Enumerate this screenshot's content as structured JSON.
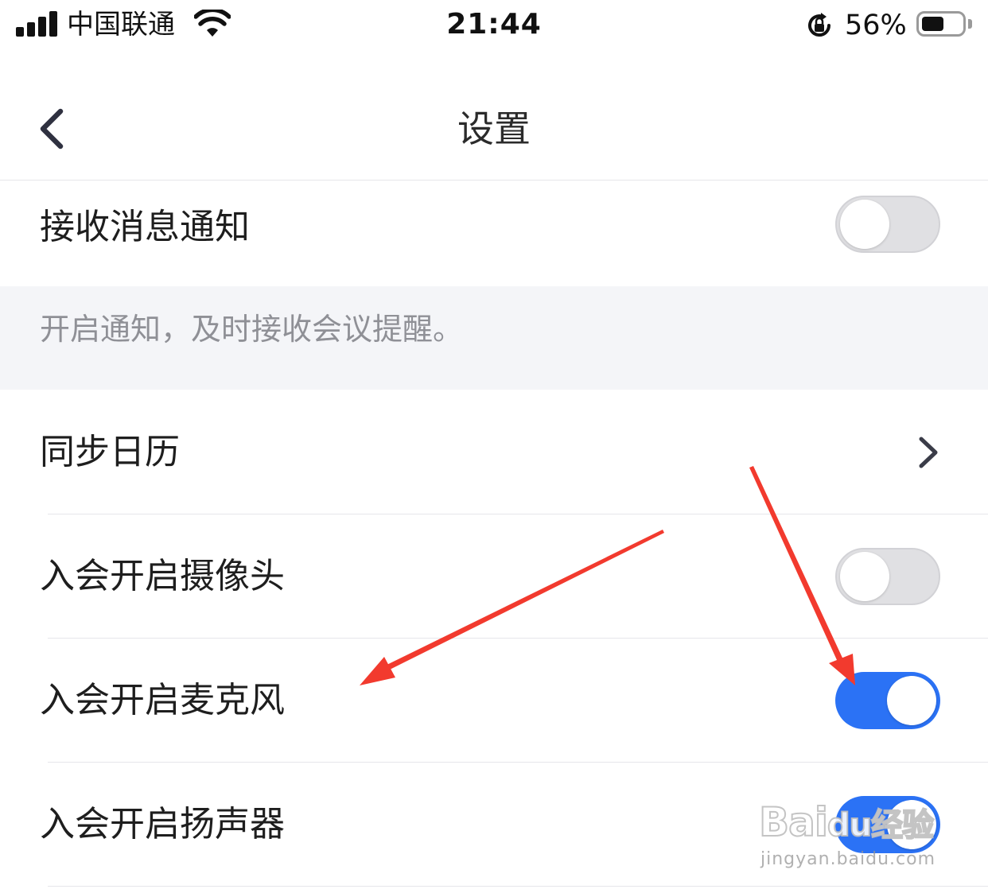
{
  "status_bar": {
    "carrier": "中国联通",
    "time": "21:44",
    "battery_percent": "56%",
    "battery_level": 0.56
  },
  "nav": {
    "title": "设置",
    "back_icon": "chevron-left-icon"
  },
  "settings": {
    "receive_notifications": {
      "label": "接收消息通知",
      "enabled": false
    },
    "notification_hint": "开启通知，及时接收会议提醒。",
    "sync_calendar": {
      "label": "同步日历",
      "icon": "chevron-right-icon"
    },
    "camera_on_join": {
      "label": "入会开启摄像头",
      "enabled": false
    },
    "mic_on_join": {
      "label": "入会开启麦克风",
      "enabled": true
    },
    "speaker_on_join": {
      "label": "入会开启扬声器",
      "enabled": true
    }
  },
  "watermark": {
    "brand": "Bai",
    "brand_cn": "经验",
    "url": "jingyan.baidu.com"
  },
  "colors": {
    "toggle_on": "#2b72f5",
    "toggle_off": "#e0e0e3",
    "hint_background": "#f4f5f8",
    "hint_text": "#8f9096",
    "annotation_arrow": "#f23a2e"
  }
}
